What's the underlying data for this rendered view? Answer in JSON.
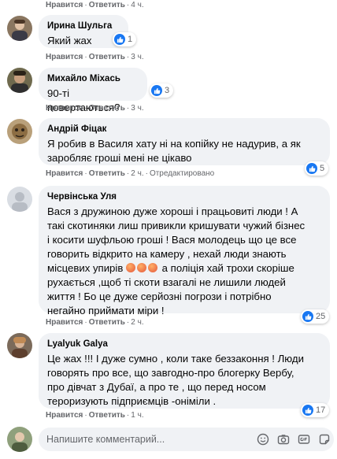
{
  "comments": [
    {
      "top_meta": {
        "like": "Нравится",
        "reply": "Ответить",
        "time": "4 ч."
      }
    },
    {
      "author": "Ирина Шульга",
      "text": "Який жах",
      "reactions": "1",
      "like": "Нравится",
      "reply": "Ответить",
      "time": "3 ч."
    },
    {
      "author": "Михайло Міхась",
      "text": "90-ті повертаються?",
      "reactions": "3",
      "like": "Нравится",
      "reply": "Ответить",
      "time": "3 ч."
    },
    {
      "author": "Андрій Фіцак",
      "text_lines": [
        "Я робив в Василя хату ні на копійку не надурив, а як",
        "заробляє гроші мені не цікаво"
      ],
      "reactions": "5",
      "like": "Нравится",
      "reply": "Ответить",
      "time": "2 ч.",
      "edited": "Отредактировано"
    },
    {
      "author": "Червінська Уля",
      "text_lines": [
        "Вася з дружиною дуже хороші і працьовиті люди ! А",
        "такі скотиняки лиш привикли кришувати чужий бізнес",
        "і косити шуфльою гроші ! Вася молодець що це все",
        "говорить відкрито на камеру , нехай люди знають",
        "місцевих упирів",
        " а поліція хай трохи скоріше",
        "рухається ,щоб ті скоти взагалі не лишили людей",
        "життя ! Бо це дуже серйозні погрози і потрібно",
        "негайно приймати міри !"
      ],
      "reactions": "25",
      "like": "Нравится",
      "reply": "Ответить",
      "time": "2 ч."
    },
    {
      "author": "Lyalyuk Galya",
      "text_lines": [
        "Це жах !!! І дуже сумно , коли таке беззаконня ! Люди",
        "говорять про все, що завгодно-про блогерку Вербу,",
        "про дівчат з Дубаї, а про те , що перед носом",
        "тероризують підприємців -оніміли ."
      ],
      "reactions": "17",
      "like": "Нравится",
      "reply": "Ответить",
      "time": "1 ч."
    }
  ],
  "composer": {
    "placeholder": "Напишите комментарий..."
  },
  "icons": {
    "like": "thumbs-up-icon",
    "composer": [
      "emoji-icon",
      "camera-icon",
      "gif-icon",
      "sticker-icon"
    ]
  },
  "colors": {
    "bubble": "#f0f2f5",
    "like_blue": "#1877f2",
    "meta_gray": "#65676b"
  }
}
